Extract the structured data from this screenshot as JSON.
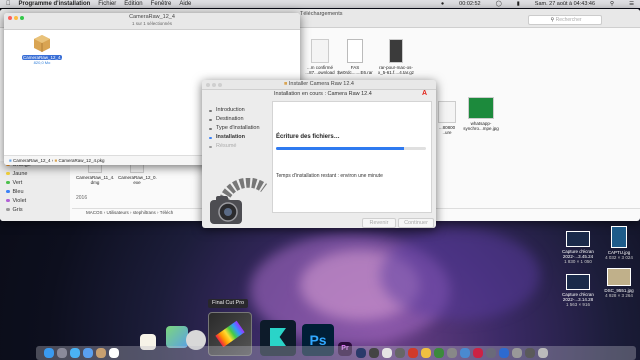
{
  "menubar": {
    "app": "Programme d'installation",
    "items": [
      "Fichier",
      "Édition",
      "Fenêtre",
      "Aide"
    ],
    "time": "00:02:52",
    "date": "Sam. 27 août à 04:43:46"
  },
  "finder_back": {
    "title": "Téléchargements",
    "search_placeholder": "Rechercher",
    "files": [
      {
        "name": "...m confirmé",
        "sub": "...87...ownload"
      },
      {
        "name": "FAS",
        "sub": "$w0rdc.......E6.rar"
      },
      {
        "name": "rar-pour-mac-os-",
        "sub": "x_5-61.f....4.tar.gz"
      },
      {
        "name": "...80800",
        "sub": "..ure"
      },
      {
        "name": "whatsapp-",
        "sub": "synchro...mpe.jpg"
      }
    ],
    "sidebar_tags": [
      "Orange",
      "Jaune",
      "Vert",
      "Bleu",
      "Violet",
      "Gris"
    ],
    "lower_files": [
      {
        "name": "CameraRaw_11_4.",
        "sub": "dmg"
      },
      {
        "name": "CameraRaw_12_0.",
        "sub": "exe"
      }
    ],
    "year_label": "2016",
    "path": [
      "MACOS",
      "Utilisateurs",
      "stephiltrans",
      "Téléch"
    ]
  },
  "finder_front": {
    "title": "CameraRaw_12_4",
    "subtitle": "1 sur 1 sélectionnés",
    "file_name": "CameraRaw_12_4.pkg",
    "file_size": "820,0 Mo",
    "path": [
      "CameraRaw_12_4",
      "CameraRaw_12_4.pkg"
    ]
  },
  "installer": {
    "title": "Installer Camera Raw 12.4",
    "header": "Installation en cours : Camera Raw 12.4",
    "steps": [
      "Introduction",
      "Destination",
      "Type d'installation",
      "Installation",
      "Résumé"
    ],
    "status": "Écriture des fichiers…",
    "progress": 0.85,
    "remaining": "Temps d'installation restant : environ une minute",
    "back_label": "Revenir",
    "continue_label": "Continuer"
  },
  "desktop_files": [
    {
      "name": "Capture d'écran",
      "sub": "2022-...3.45.24",
      "dim": "1 830 × 1 050"
    },
    {
      "name": "CAPTU.jpg",
      "sub": "",
      "dim": "4 032 × 3 024"
    },
    {
      "name": "Capture d'écran",
      "sub": "2022-...3.14.28",
      "dim": "1 563 × 916"
    },
    {
      "name": "DSC_9551.jpg",
      "sub": "",
      "dim": "4 928 × 3 264"
    }
  ],
  "dock": {
    "tooltip": "Final Cut Pro",
    "ps_label": "Ps",
    "pr_label": "Pr"
  }
}
